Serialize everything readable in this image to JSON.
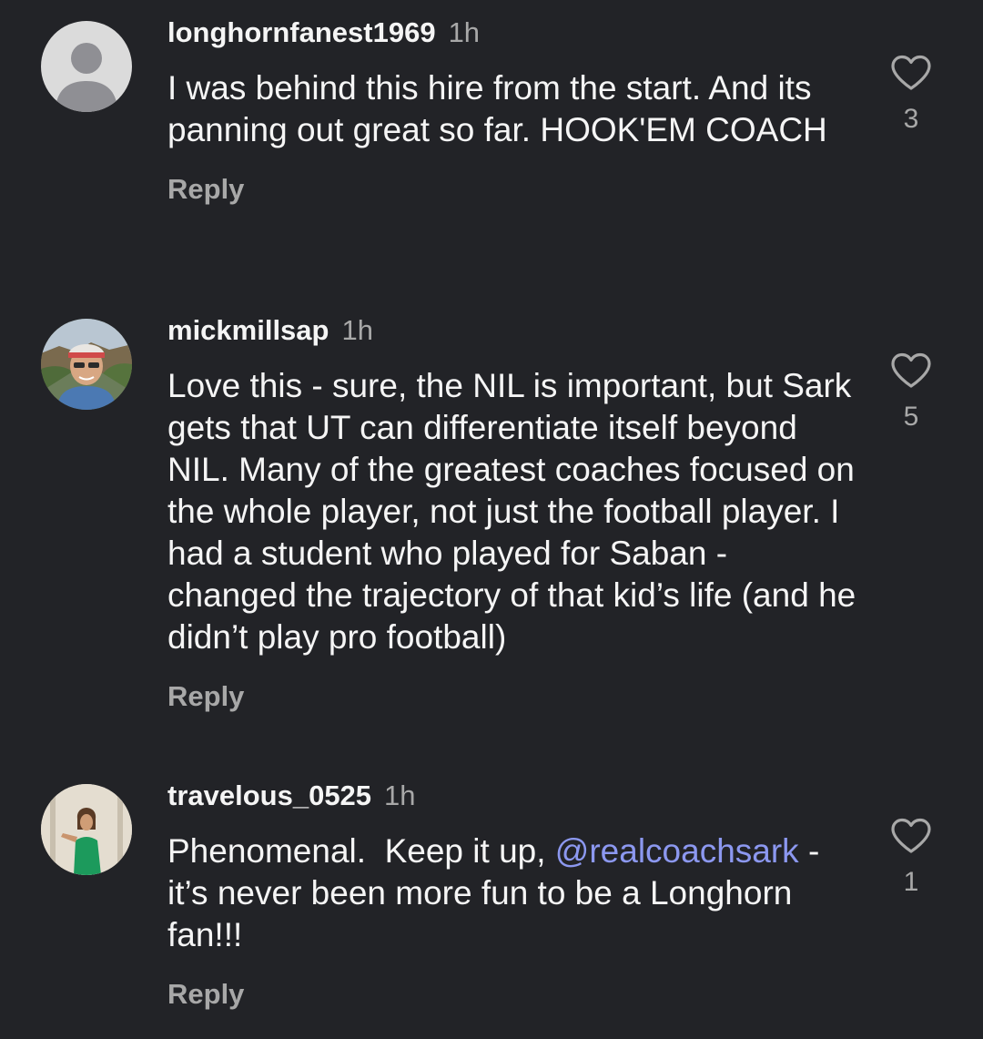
{
  "comments": [
    {
      "username": "longhornfanest1969",
      "time": "1h",
      "text": "I was behind this hire from the start. And its panning out great so far. HOOK'EM COACH",
      "reply_label": "Reply",
      "likes": "3",
      "avatar": "default-avatar-icon"
    },
    {
      "username": "mickmillsap",
      "time": "1h",
      "text": "Love this - sure, the NIL is important, but Sark gets that UT can differentiate itself beyond NIL. Many of the greatest coaches focused on the whole player, not just the football player. I had a student who played for Saban - changed the trajectory of that kid’s life (and he didn’t play pro football)",
      "reply_label": "Reply",
      "likes": "5",
      "avatar": "user-photo"
    },
    {
      "username": "travelous_0525",
      "time": "1h",
      "text_before": "Phenomenal.  Keep it up, ",
      "mention": "@realcoachsark",
      "text_after": " - it’s never been more fun to be a Longhorn fan!!!",
      "reply_label": "Reply",
      "likes": "1",
      "avatar": "user-photo"
    }
  ],
  "colors": {
    "background": "#222327",
    "primary_text": "#f5f5f5",
    "secondary_text": "#a8a8a8",
    "mention": "#8c98f0"
  }
}
